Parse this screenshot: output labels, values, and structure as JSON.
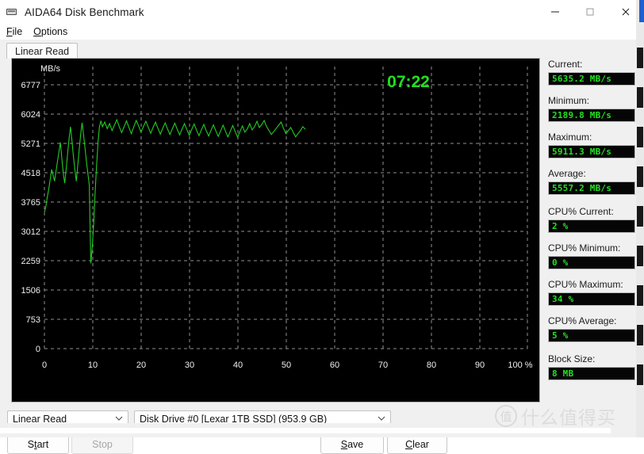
{
  "window": {
    "title": "AIDA64 Disk Benchmark",
    "icon": "disk-benchmark-icon",
    "controls": {
      "minimize": "minimize-icon",
      "maximize": "maximize-icon",
      "close": "close-icon"
    }
  },
  "menu": {
    "items": [
      {
        "label": "File",
        "accel": "F"
      },
      {
        "label": "Options",
        "accel": "O"
      }
    ]
  },
  "tabs": [
    {
      "label": "Linear Read",
      "active": true
    }
  ],
  "graph": {
    "unit_label": "MB/s",
    "timer": "07:22",
    "timer_color": "#20e020",
    "line_color": "#22cc22",
    "background": "#000000",
    "grid_color": "#9a9a9a"
  },
  "chart_data": {
    "type": "line",
    "title": "Linear Read",
    "xlabel": "",
    "ylabel": "MB/s",
    "x_unit": "%",
    "xlim": [
      0,
      100
    ],
    "ylim": [
      0,
      6777
    ],
    "grid": true,
    "legend": "none",
    "x_ticks": [
      0,
      10,
      20,
      30,
      40,
      50,
      60,
      70,
      80,
      90,
      100
    ],
    "x_tick_labels": [
      "0",
      "10",
      "20",
      "30",
      "40",
      "50",
      "60",
      "70",
      "80",
      "90",
      "100 %"
    ],
    "y_ticks": [
      0,
      753,
      1506,
      2259,
      3012,
      3765,
      4518,
      5271,
      6024,
      6777
    ],
    "y_tick_labels": [
      "0",
      "753",
      "1506",
      "2259",
      "3012",
      "3765",
      "4518",
      "5271",
      "6024",
      "6777"
    ],
    "series": [
      {
        "name": "Linear Read",
        "color": "#22cc22",
        "x": [
          0.0,
          0.3,
          0.6,
          0.9,
          1.2,
          1.5,
          1.8,
          2.1,
          2.4,
          2.7,
          3.0,
          3.3,
          3.6,
          3.9,
          4.2,
          4.5,
          4.8,
          5.1,
          5.4,
          5.7,
          6.0,
          6.3,
          6.6,
          6.9,
          7.2,
          7.5,
          7.8,
          8.1,
          8.4,
          8.7,
          9.0,
          9.3,
          9.6,
          9.9,
          10.2,
          10.5,
          10.8,
          11.1,
          11.4,
          11.7,
          12.0,
          12.5,
          13.0,
          13.5,
          14.0,
          14.5,
          15.0,
          15.5,
          16.0,
          16.5,
          17.0,
          17.5,
          18.0,
          18.5,
          19.0,
          19.5,
          20.0,
          20.5,
          21.0,
          21.5,
          22.0,
          22.5,
          23.0,
          23.5,
          24.0,
          24.5,
          25.0,
          25.5,
          26.0,
          26.5,
          27.0,
          27.5,
          28.0,
          28.5,
          29.0,
          29.5,
          30.0,
          30.5,
          31.0,
          31.5,
          32.0,
          32.5,
          33.0,
          33.5,
          34.0,
          34.5,
          35.0,
          35.5,
          36.0,
          36.5,
          37.0,
          37.5,
          38.0,
          38.5,
          39.0,
          39.5,
          40.0,
          40.5,
          41.0,
          41.5,
          42.0,
          42.5,
          43.0,
          43.5,
          44.0,
          44.5,
          45.0,
          45.5,
          46.0,
          46.5,
          47.0,
          47.5,
          48.0,
          48.5,
          49.0,
          49.5,
          50.0,
          50.5,
          51.0,
          51.5,
          52.0,
          52.5,
          53.0,
          53.5,
          54.0,
          54.5,
          55.0
        ],
        "y": [
          3500,
          3650,
          3900,
          4100,
          4350,
          4600,
          4450,
          4300,
          4550,
          4800,
          5050,
          5300,
          4900,
          4500,
          4250,
          4600,
          5000,
          5400,
          5700,
          5350,
          4950,
          4600,
          4300,
          4700,
          5100,
          5500,
          5800,
          5500,
          5150,
          4800,
          4500,
          4200,
          2190,
          2600,
          3200,
          4000,
          4700,
          5300,
          5700,
          5850,
          5700,
          5820,
          5650,
          5780,
          5600,
          5740,
          5880,
          5700,
          5550,
          5700,
          5850,
          5680,
          5520,
          5700,
          5860,
          5720,
          5560,
          5700,
          5840,
          5690,
          5530,
          5680,
          5820,
          5660,
          5510,
          5660,
          5800,
          5640,
          5500,
          5650,
          5790,
          5630,
          5490,
          5640,
          5780,
          5620,
          5480,
          5630,
          5770,
          5610,
          5470,
          5620,
          5760,
          5600,
          5460,
          5610,
          5750,
          5590,
          5450,
          5600,
          5740,
          5580,
          5440,
          5590,
          5730,
          5570,
          5430,
          5580,
          5720,
          5560,
          5640,
          5780,
          5620,
          5700,
          5840,
          5680,
          5760,
          5860,
          5700,
          5600,
          5500,
          5580,
          5660,
          5740,
          5820,
          5660,
          5520,
          5600,
          5680,
          5560,
          5440,
          5520,
          5600,
          5700,
          5635
        ]
      }
    ]
  },
  "readouts": [
    {
      "label": "Current:",
      "value": "5635.2 MB/s",
      "name": "current"
    },
    {
      "label": "Minimum:",
      "value": "2189.8 MB/s",
      "name": "minimum"
    },
    {
      "label": "Maximum:",
      "value": "5911.3 MB/s",
      "name": "maximum"
    },
    {
      "label": "Average:",
      "value": "5557.2 MB/s",
      "name": "average"
    },
    {
      "label": "CPU% Current:",
      "value": "2 %",
      "name": "cpu-current"
    },
    {
      "label": "CPU% Minimum:",
      "value": "0 %",
      "name": "cpu-minimum"
    },
    {
      "label": "CPU% Maximum:",
      "value": "34 %",
      "name": "cpu-maximum"
    },
    {
      "label": "CPU% Average:",
      "value": "5 %",
      "name": "cpu-average"
    },
    {
      "label": "Block Size:",
      "value": "8 MB",
      "name": "block-size"
    }
  ],
  "controls": {
    "test_select": {
      "value": "Linear Read"
    },
    "drive_select": {
      "value": "Disk Drive #0  [Lexar 1TB SSD]  (953.9 GB)"
    },
    "start": {
      "label": "Start",
      "accel": "t",
      "enabled": true
    },
    "stop": {
      "label": "Stop",
      "accel": "",
      "enabled": false
    },
    "save": {
      "label": "Save",
      "accel": "S",
      "enabled": true
    },
    "clear": {
      "label": "Clear",
      "accel": "C",
      "enabled": true
    }
  },
  "watermark": {
    "logo": "值",
    "text": "什么值得买"
  }
}
